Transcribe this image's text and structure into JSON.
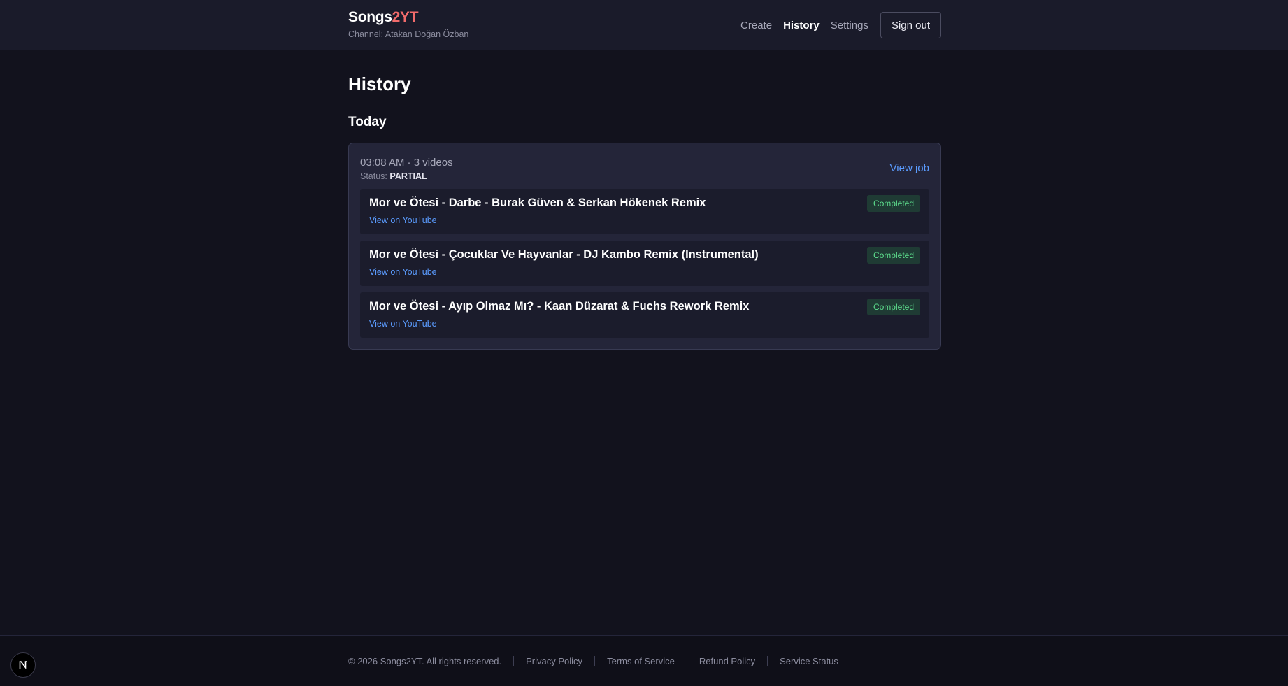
{
  "brand": {
    "name_main": "Songs",
    "name_accent": "2YT",
    "channel": "Channel: Atakan Doğan Özban"
  },
  "nav": {
    "items": [
      {
        "label": "Create"
      },
      {
        "label": "History"
      },
      {
        "label": "Settings"
      }
    ],
    "signout": "Sign out"
  },
  "page": {
    "title": "History",
    "section": "Today"
  },
  "job": {
    "time_summary": "03:08 AM · 3 videos",
    "status_label": "Status:",
    "status_value": "PARTIAL",
    "view_job": "View job",
    "videos": [
      {
        "title": "Mor ve Ötesi - Darbe - Burak Güven & Serkan Hökenek Remix",
        "link": "View on YouTube",
        "status": "Completed"
      },
      {
        "title": "Mor ve Ötesi - Çocuklar Ve Hayvanlar - DJ Kambo Remix (Instrumental)",
        "link": "View on YouTube",
        "status": "Completed"
      },
      {
        "title": "Mor ve Ötesi - Ayıp Olmaz Mı? - Kaan Düzarat & Fuchs Rework Remix",
        "link": "View on YouTube",
        "status": "Completed"
      }
    ]
  },
  "footer": {
    "copyright": "© 2026 Songs2YT. All rights reserved.",
    "links": [
      {
        "label": "Privacy Policy"
      },
      {
        "label": "Terms of Service"
      },
      {
        "label": "Refund Policy"
      },
      {
        "label": "Service Status"
      }
    ]
  },
  "dev_badge": {
    "letter": "N"
  },
  "colors": {
    "accent": "#f26b6b",
    "link": "#5b9cff",
    "success": "#5ee08e",
    "background": "#12121d"
  }
}
